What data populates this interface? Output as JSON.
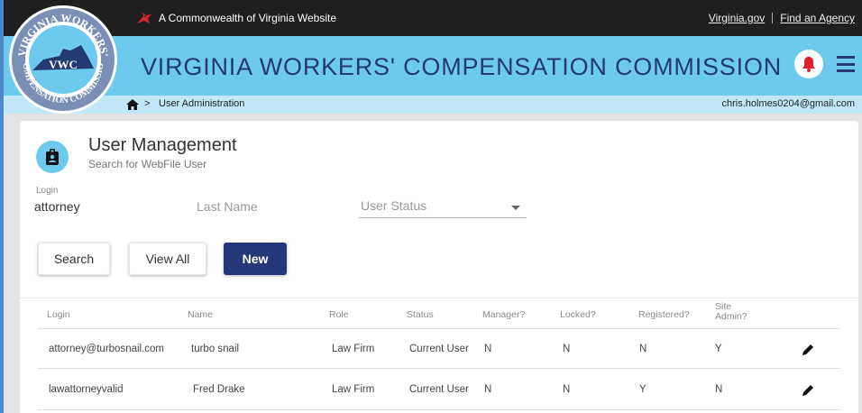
{
  "topbar": {
    "commonwealth_text": "A Commonwealth of Virginia Website",
    "links": [
      "Virginia.gov",
      "Find an Agency"
    ]
  },
  "logo": {
    "top_text": "VIRGINIA WORKERS'",
    "bottom_text": "COMPENSATION COMMISSION",
    "center_text": "VWC"
  },
  "header": {
    "title": "VIRGINIA WORKERS' COMPENSATION COMMISSION",
    "bell_icon": "notification-bell-icon",
    "menu_icon": "hamburger-menu-icon"
  },
  "breadcrumb": {
    "home_icon": "home-icon",
    "separator": ">",
    "page": "User Administration",
    "user_email": "chris.holmes0204@gmail.com"
  },
  "user_management": {
    "icon": "id-badge-icon",
    "title": "User Management",
    "subtitle": "Search for WebFile User"
  },
  "search_form": {
    "login_label": "Login",
    "login_value": "attorney",
    "last_name_placeholder": "Last Name",
    "user_status_placeholder": "User Status"
  },
  "buttons": {
    "search": "Search",
    "view_all": "View All",
    "new": "New"
  },
  "table": {
    "columns": [
      "Login",
      "Name",
      "Role",
      "Status",
      "Manager?",
      "Locked?",
      "Registered?",
      "Site Admin?"
    ],
    "rows": [
      [
        "attorney@turbosnail.com",
        "turbo snail",
        "Law Firm",
        "Current User",
        "N",
        "N",
        "N",
        "Y"
      ],
      [
        "lawattorneyvalid",
        "Fred Drake",
        "Law Firm",
        "Current User",
        "N",
        "N",
        "Y",
        "N"
      ]
    ]
  },
  "colors": {
    "top_bar": "#1f1f1f",
    "header_blue": "#6dcaee",
    "breadcrumb_blue": "#bfe7f7",
    "title_navy": "#243a72",
    "primary_button": "#263779",
    "bell_red": "#e0202a"
  }
}
